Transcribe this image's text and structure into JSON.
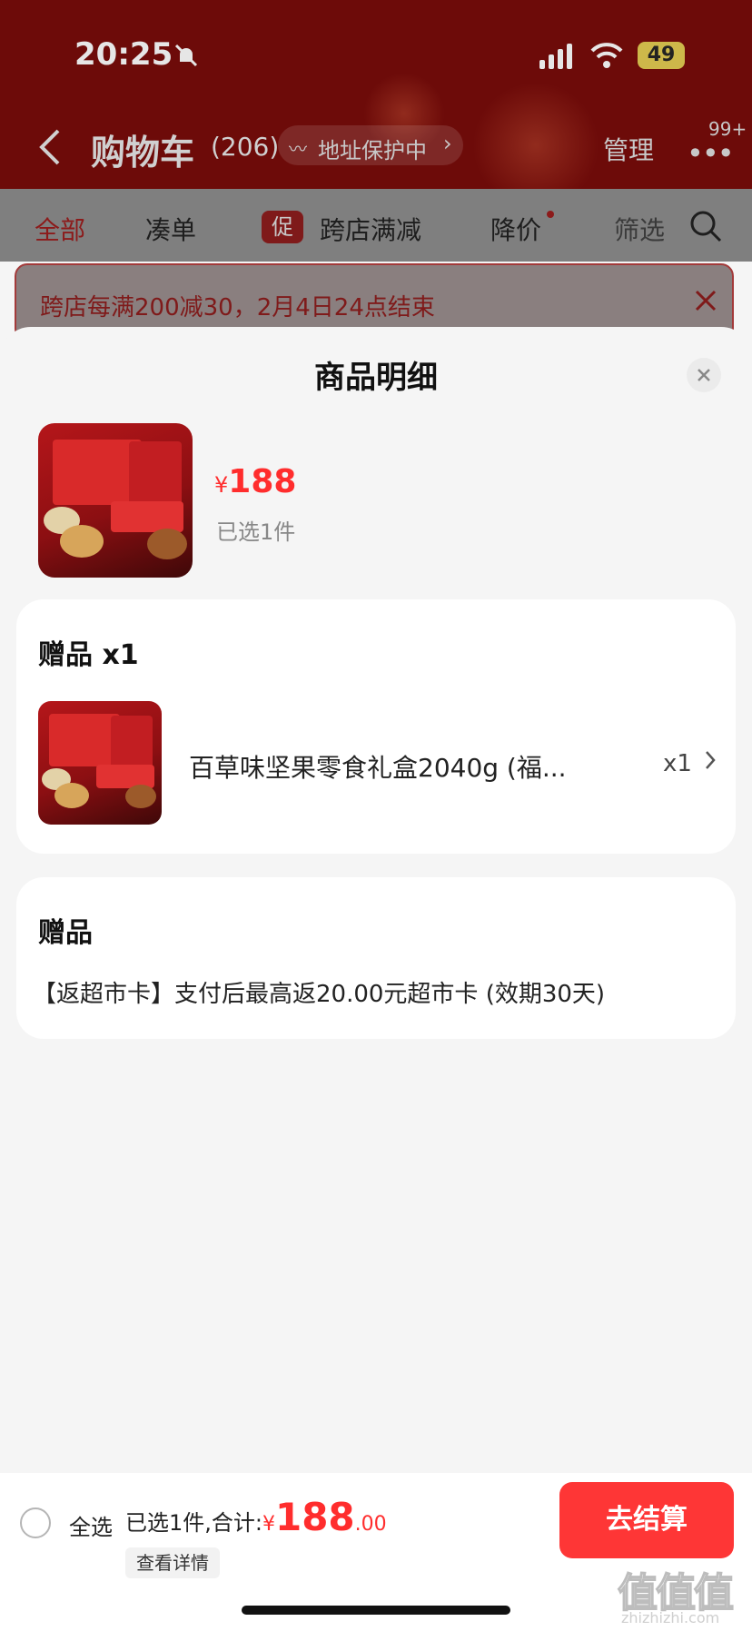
{
  "status_bar": {
    "time": "20:25",
    "battery": "49"
  },
  "header": {
    "title": "购物车",
    "count": "(206)",
    "address_badge": "地址保护中",
    "manage": "管理",
    "more_badge": "99+"
  },
  "tabs": [
    {
      "label": "全部"
    },
    {
      "label": "凑单"
    },
    {
      "label": "跨店满减",
      "tag": "促"
    },
    {
      "label": "降价"
    },
    {
      "label": "筛选"
    }
  ],
  "notice": {
    "text": "跨店每满200减30，2月4日24点结束"
  },
  "sheet": {
    "title": "商品明细",
    "product": {
      "currency": "¥",
      "price": "188",
      "selected": "已选1件"
    },
    "gift_card": {
      "title": "赠品 x1",
      "item_name": "百草味坚果零食礼盒2040g (福...",
      "item_qty": "x1"
    },
    "gift_note": {
      "title": "赠品",
      "text": "【返超市卡】支付后最高返20.00元超市卡 (效期30天)"
    }
  },
  "bottom_bar": {
    "select_all": "全选",
    "summary": "已选1件,合计:",
    "currency": "¥",
    "total_int": "188",
    "total_dec": ".00",
    "details": "查看详情",
    "checkout": "去结算"
  },
  "watermark": {
    "logo": "值值值",
    "url": "zhizhizhi.com"
  },
  "colors": {
    "accent": "#ff2d2d",
    "header_bg": "#6d0b09",
    "checkout_bg": "#fe3636"
  }
}
